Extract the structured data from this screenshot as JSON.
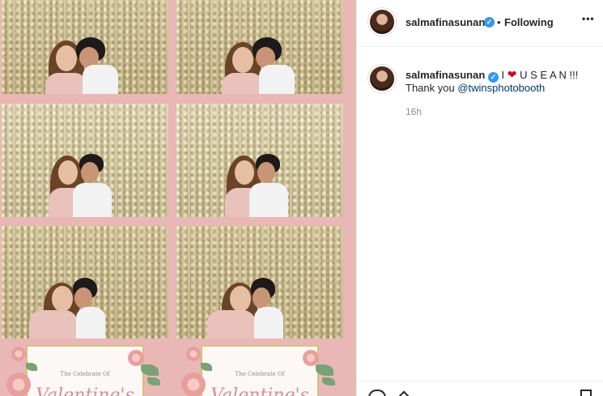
{
  "post": {
    "header": {
      "username": "salmafinasunan",
      "separator": "•",
      "follow_status": "Following",
      "more_label": "•••"
    },
    "caption": {
      "username": "salmafinasunan",
      "text_before_heart": "I",
      "heart": "❤",
      "text_after_heart": "U S E A N !!!",
      "line2_prefix": "Thank you",
      "mention": "@twinsphotobooth"
    },
    "timestamp": "16h"
  },
  "media": {
    "card_text": "The Celebrate Of",
    "card_script": "Valentine's"
  },
  "icons": {
    "verified": "✓"
  },
  "colors": {
    "strip_background": "#e9b8b6",
    "verified_badge": "#3897f0",
    "heart": "#d0021b",
    "mention": "#00376b",
    "muted_text": "#8e8e8e"
  }
}
